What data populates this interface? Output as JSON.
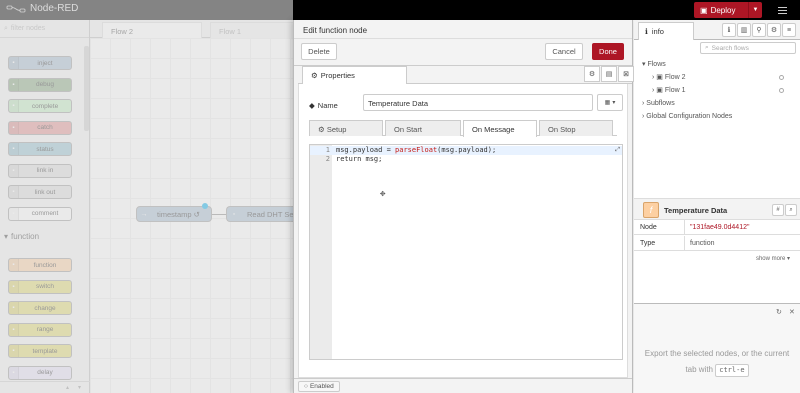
{
  "header": {
    "app_name": "Node-RED",
    "deploy_label": "Deploy"
  },
  "palette": {
    "filter_placeholder": "filter nodes",
    "common_nodes": [
      {
        "label": "inject",
        "color": "#a6bbcf"
      },
      {
        "label": "debug",
        "color": "#87a980"
      },
      {
        "label": "complete",
        "color": "#c0edc0"
      },
      {
        "label": "catch",
        "color": "#e49191"
      },
      {
        "label": "status",
        "color": "#94c1d0"
      },
      {
        "label": "link in",
        "color": "#dddddd"
      },
      {
        "label": "link out",
        "color": "#dddddd"
      },
      {
        "label": "comment",
        "color": "#ffffff"
      }
    ],
    "function_category": "function",
    "function_nodes": [
      {
        "label": "function",
        "color": "#fdd0a2"
      },
      {
        "label": "switch",
        "color": "#e2d96e"
      },
      {
        "label": "change",
        "color": "#e2d96e"
      },
      {
        "label": "range",
        "color": "#e2d96e"
      },
      {
        "label": "template",
        "color": "#e2d96e"
      },
      {
        "label": "delay",
        "color": "#e6e0f8"
      }
    ]
  },
  "workspace": {
    "tabs": [
      "Flow 2",
      "Flow 1"
    ],
    "nodes": [
      {
        "label": "timestamp ↺",
        "color": "#a6bbcf"
      },
      {
        "label": "Read DHT Se",
        "color": "#a6bbcf"
      }
    ]
  },
  "tray": {
    "title": "Edit function node",
    "delete_label": "Delete",
    "cancel_label": "Cancel",
    "done_label": "Done",
    "properties_tab": "Properties",
    "name_label": "Name",
    "name_value": "Temperature Data",
    "subtabs": [
      "Setup",
      "On Start",
      "On Message",
      "On Stop"
    ],
    "active_subtab": "On Message",
    "code_lines": [
      {
        "num": "1",
        "text_a": "msg.payload = ",
        "text_fn": "parseFloat",
        "text_b": "(msg.payload);"
      },
      {
        "num": "2",
        "text_a": "return msg;",
        "text_fn": "",
        "text_b": ""
      }
    ],
    "enabled_label": "Enabled"
  },
  "sidebar": {
    "info_tab": "info",
    "search_placeholder": "Search flows",
    "tree": {
      "flows_label": "Flows",
      "flow_items": [
        "Flow 2",
        "Flow 1"
      ],
      "subflows_label": "Subflows",
      "global_label": "Global Configuration Nodes"
    },
    "selected": {
      "name": "Temperature Data",
      "props": [
        {
          "key": "Node",
          "value": "\"131fae49.0d4412\""
        },
        {
          "key": "Type",
          "value": "function"
        }
      ],
      "show_more": "show more ▾"
    },
    "help": {
      "text_before": "Export the selected nodes, or the current tab with",
      "kbd": "ctrl-e"
    }
  }
}
